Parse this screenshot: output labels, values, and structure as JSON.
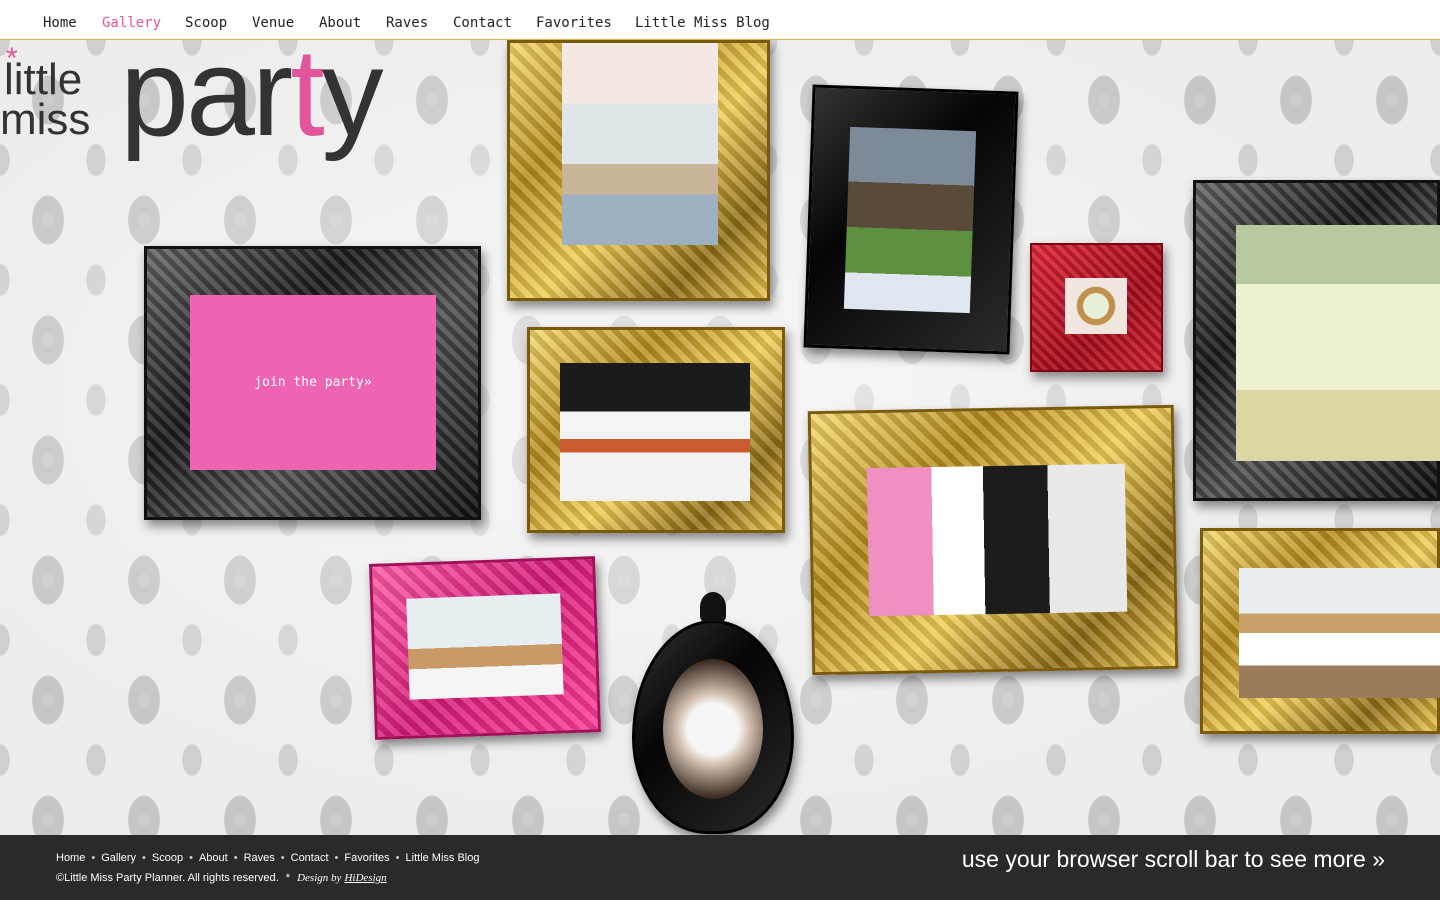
{
  "nav": {
    "items": [
      {
        "label": "Home"
      },
      {
        "label": "Gallery",
        "active": true
      },
      {
        "label": "Scoop"
      },
      {
        "label": "Venue"
      },
      {
        "label": "About"
      },
      {
        "label": "Raves"
      },
      {
        "label": "Contact"
      },
      {
        "label": "Favorites"
      },
      {
        "label": "Little Miss Blog"
      }
    ],
    "active_color": "#e2559c"
  },
  "logo": {
    "little": "little",
    "miss": "miss",
    "party_start": "par",
    "party_pink": "t",
    "party_end": "y",
    "star": "*"
  },
  "join": {
    "label": "join the party»"
  },
  "footer": {
    "links": [
      "Home",
      "Gallery",
      "Scoop",
      "About",
      "Raves",
      "Contact",
      "Favorites",
      "Little Miss Blog"
    ],
    "separator": "•",
    "copyright": "©Little Miss Party Planner. All rights reserved.",
    "star": "*",
    "design_label": "Design by",
    "design_link": "HiDesign",
    "scroll_note": "use your browser scroll bar to see more »"
  },
  "colors": {
    "brand_pink": "#e2559c",
    "join_pink": "#ee64b2",
    "footer_bg": "#2a2a2a",
    "nav_rule": "#d9b34a"
  }
}
